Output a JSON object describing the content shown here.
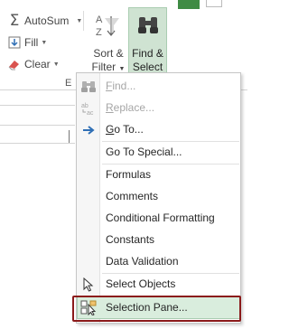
{
  "ribbon": {
    "autosum_label": "AutoSum",
    "fill_label": "Fill",
    "clear_label": "Clear",
    "sort_label_1": "Sort &",
    "sort_label_2": "Filter",
    "find_label_1": "Find &",
    "find_label_2": "Select",
    "group_label": "E",
    "accent": "#3f8b44"
  },
  "menu": {
    "items": [
      {
        "label": "Find...",
        "icon": "binoculars-icon",
        "enabled": false
      },
      {
        "label": "Replace...",
        "icon": "replace-icon",
        "enabled": false
      },
      {
        "label": "Go To...",
        "icon": "arrow-right-icon",
        "enabled": true
      },
      {
        "label": "Go To Special...",
        "icon": "",
        "enabled": true
      },
      {
        "label": "Formulas",
        "icon": "",
        "enabled": true
      },
      {
        "label": "Comments",
        "icon": "",
        "enabled": true
      },
      {
        "label": "Conditional Formatting",
        "icon": "",
        "enabled": true
      },
      {
        "label": "Constants",
        "icon": "",
        "enabled": true
      },
      {
        "label": "Data Validation",
        "icon": "",
        "enabled": true
      },
      {
        "label": "Select Objects",
        "icon": "cursor-icon",
        "enabled": true
      },
      {
        "label": "Selection Pane...",
        "icon": "selection-pane-icon",
        "enabled": true,
        "highlighted": true
      }
    ],
    "highlight_color": "#d9eddd",
    "callout_color": "#8b1a1a"
  }
}
